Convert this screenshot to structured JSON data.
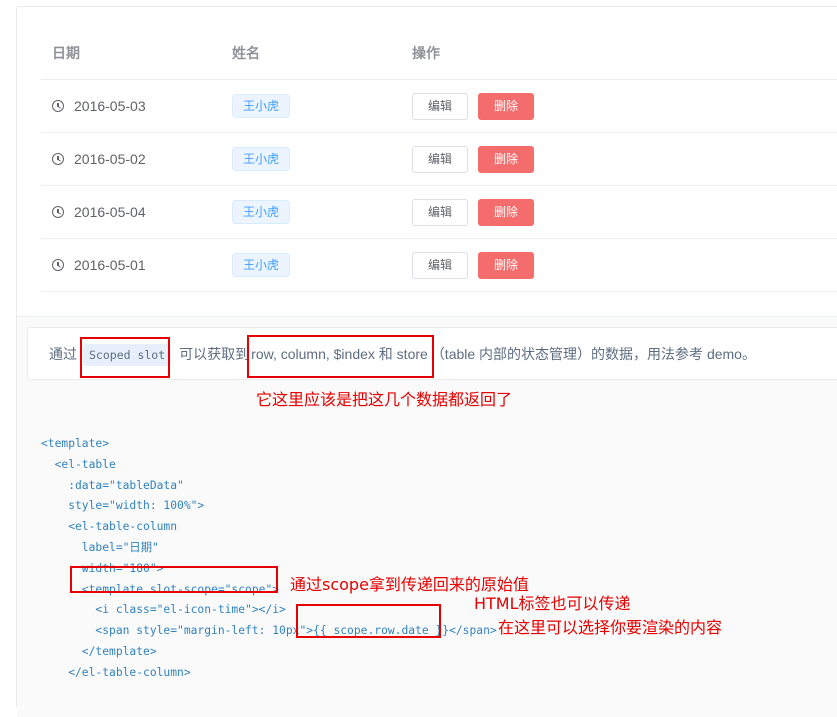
{
  "table": {
    "columns": [
      "日期",
      "姓名",
      "操作"
    ],
    "rows": [
      {
        "date": "2016-05-03",
        "name": "王小虎",
        "edit": "编辑",
        "delete": "删除"
      },
      {
        "date": "2016-05-02",
        "name": "王小虎",
        "edit": "编辑",
        "delete": "删除"
      },
      {
        "date": "2016-05-04",
        "name": "王小虎",
        "edit": "编辑",
        "delete": "删除"
      },
      {
        "date": "2016-05-01",
        "name": "王小虎",
        "edit": "编辑",
        "delete": "删除"
      }
    ]
  },
  "description": {
    "prefix": "通过",
    "code": "Scoped slot",
    "middle": "可以获取到",
    "highlight": "row, column, $index 和 store",
    "suffix": "（table 内部的状态管理）的数据，用法参考 demo。"
  },
  "code_lines": [
    "<template>",
    "  <el-table",
    "    :data=\"tableData\"",
    "    style=\"width: 100%\">",
    "    <el-table-column",
    "      label=\"日期\"",
    "      width=\"180\">",
    "      <template slot-scope=\"scope\">",
    "        <i class=\"el-icon-time\"></i>",
    "        <span style=\"margin-left: 10px\">{{ scope.row.date }}</span>",
    "      </template>",
    "    </el-table-column>"
  ],
  "annotations": {
    "returned_data": "它这里应该是把这几个数据都返回了",
    "scope_value": "通过scope拿到传递回来的原始值",
    "html_tags": "HTML标签也可以传递",
    "render_choice": "在这里可以选择你要渲染的内容"
  },
  "colors": {
    "primary": "#409eff",
    "danger": "#f56c6c",
    "annotation": "#e60000"
  }
}
